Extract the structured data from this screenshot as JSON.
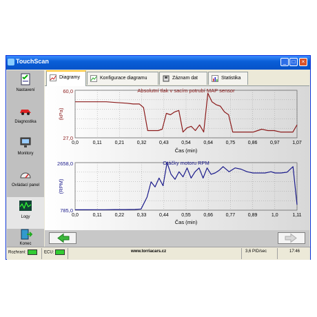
{
  "window": {
    "title": "TouchScan"
  },
  "sidebar": {
    "items": [
      {
        "label": "Nastavení",
        "icon": "settings-checklist-icon"
      },
      {
        "label": "Diagnostika",
        "icon": "car-diagnostics-icon"
      },
      {
        "label": "Monitory",
        "icon": "monitor-icon"
      },
      {
        "label": "Ovládací panel",
        "icon": "gauge-icon"
      },
      {
        "label": "Logy",
        "icon": "log-wave-icon"
      },
      {
        "label": "Konec",
        "icon": "exit-icon"
      }
    ],
    "active_index": 4
  },
  "tabs": [
    {
      "label": "Diagramy",
      "icon": "chart-icon"
    },
    {
      "label": "Konfigurace diagramu",
      "icon": "chart-config-icon"
    },
    {
      "label": "Záznam dat",
      "icon": "record-icon"
    },
    {
      "label": "Statistika",
      "icon": "statistics-icon"
    }
  ],
  "active_tab": 0,
  "chart_data": [
    {
      "type": "line",
      "title": "Absolutní tlak v sacím potrubí MAP sensor",
      "xlabel": "Čas (min)",
      "ylabel": "(kPa)",
      "ymax_label": "60,0",
      "ymin_label": "27,0",
      "ylim": [
        27,
        60
      ],
      "xlim": [
        0,
        1.07
      ],
      "xtick_labels": [
        "0,0",
        "0,11",
        "0,21",
        "0,32",
        "0,43",
        "0,54",
        "0,64",
        "0,75",
        "0,86",
        "0,97",
        "1,07"
      ],
      "color": "#8b1a1a",
      "x": [
        0,
        0.05,
        0.1,
        0.15,
        0.2,
        0.25,
        0.28,
        0.31,
        0.33,
        0.35,
        0.38,
        0.4,
        0.42,
        0.44,
        0.46,
        0.48,
        0.5,
        0.52,
        0.54,
        0.56,
        0.58,
        0.6,
        0.62,
        0.64,
        0.66,
        0.68,
        0.7,
        0.72,
        0.74,
        0.76,
        0.78,
        0.8,
        0.83,
        0.86,
        0.88,
        0.9,
        0.93,
        0.96,
        0.99,
        1.02,
        1.05,
        1.07
      ],
      "y": [
        52,
        52,
        52,
        52,
        51.5,
        51,
        50.5,
        50.5,
        48,
        32,
        32,
        32,
        33,
        44,
        43,
        45,
        46,
        31,
        34,
        35,
        32,
        36,
        31,
        58,
        52,
        50,
        49,
        45,
        43,
        31,
        31,
        31,
        31,
        31,
        32,
        33,
        32,
        32,
        31,
        31,
        31,
        36
      ]
    },
    {
      "type": "line",
      "title": "Otáčky motoru RPM",
      "xlabel": "Čas (min)",
      "ylabel": "(RPM)",
      "ymax_label": "2658,0",
      "ymin_label": "785,0",
      "ylim": [
        785,
        2658
      ],
      "xlim": [
        0,
        1.11
      ],
      "xtick_labels": [
        "0,0",
        "0,11",
        "0,22",
        "0,33",
        "0,44",
        "0,55",
        "0,66",
        "0,77",
        "0,89",
        "1,0",
        "1,11"
      ],
      "color": "#1a1a8b",
      "x": [
        0,
        0.05,
        0.1,
        0.15,
        0.2,
        0.25,
        0.3,
        0.33,
        0.36,
        0.38,
        0.4,
        0.42,
        0.44,
        0.46,
        0.48,
        0.5,
        0.52,
        0.54,
        0.56,
        0.58,
        0.6,
        0.62,
        0.64,
        0.66,
        0.68,
        0.7,
        0.72,
        0.74,
        0.77,
        0.8,
        0.83,
        0.86,
        0.89,
        0.92,
        0.95,
        0.98,
        1.0,
        1.03,
        1.06,
        1.09,
        1.11
      ],
      "y": [
        800,
        800,
        805,
        805,
        810,
        810,
        815,
        830,
        1300,
        1900,
        1700,
        2050,
        1750,
        2658,
        2200,
        2000,
        2300,
        2100,
        2450,
        2050,
        2300,
        2450,
        2050,
        2450,
        2200,
        2250,
        2350,
        2500,
        2300,
        2450,
        2400,
        2300,
        2250,
        2250,
        2250,
        2300,
        2250,
        2250,
        2280,
        2500,
        1000
      ]
    }
  ],
  "nav": {
    "prev_icon": "arrow-left-icon",
    "next_icon": "arrow-right-icon"
  },
  "status": {
    "rozhrani_label": "Rozhraní:",
    "ecu_label": "ECU:",
    "website": "www.torriacars.cz",
    "rate": "3,6 PID/sec",
    "time": "17:46"
  },
  "colors": {
    "led_on": "#33cc33",
    "titlebar": "#0a5fd8",
    "tab_accent": "#ffc83c"
  }
}
